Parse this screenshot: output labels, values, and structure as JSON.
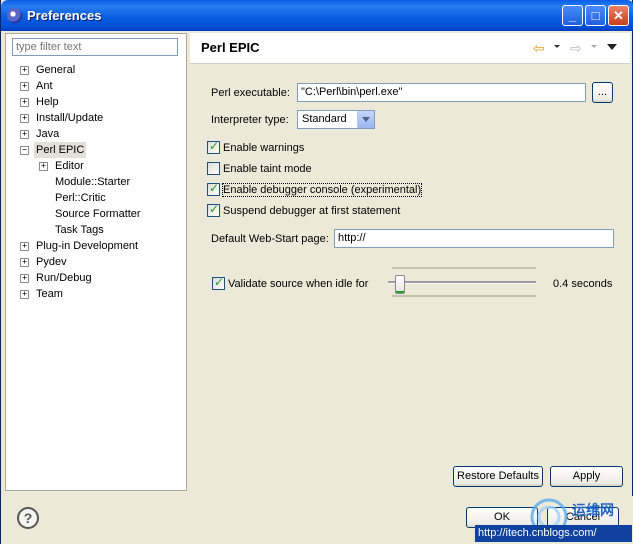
{
  "window": {
    "title": "Preferences"
  },
  "filter": {
    "placeholder": "type filter text"
  },
  "tree": {
    "items": [
      {
        "label": "General",
        "expandable": true
      },
      {
        "label": "Ant",
        "expandable": true
      },
      {
        "label": "Help",
        "expandable": true
      },
      {
        "label": "Install/Update",
        "expandable": true
      },
      {
        "label": "Java",
        "expandable": true
      },
      {
        "label": "Perl EPIC",
        "expandable": true,
        "expanded": true,
        "selected": true
      },
      {
        "label": "Editor",
        "expandable": true,
        "child": true
      },
      {
        "label": "Module::Starter",
        "child": true
      },
      {
        "label": "Perl::Critic",
        "child": true
      },
      {
        "label": "Source Formatter",
        "child": true
      },
      {
        "label": "Task Tags",
        "child": true
      },
      {
        "label": "Plug-in Development",
        "expandable": true
      },
      {
        "label": "Pydev",
        "expandable": true
      },
      {
        "label": "Run/Debug",
        "expandable": true
      },
      {
        "label": "Team",
        "expandable": true
      }
    ]
  },
  "page": {
    "title": "Perl EPIC",
    "perl_executable_label": "Perl executable:",
    "perl_executable_value": "\"C:\\Perl\\bin\\perl.exe\"",
    "browse_label": "...",
    "interpreter_label": "Interpreter type:",
    "interpreter_value": "Standard",
    "checkboxes": [
      {
        "label": "Enable warnings",
        "checked": true
      },
      {
        "label": "Enable taint mode",
        "checked": false
      },
      {
        "label": "Enable debugger console (experimental)",
        "checked": true
      },
      {
        "label": "Suspend debugger at first statement",
        "checked": true
      }
    ],
    "webstart_label": "Default Web-Start page:",
    "webstart_value": "http://",
    "validate_label": "Validate source when idle for",
    "validate_checked": true,
    "validate_seconds": "0.4 seconds",
    "restore_defaults": "Restore Defaults",
    "apply": "Apply"
  },
  "footer": {
    "help_glyph": "?",
    "ok": "OK",
    "cancel": "Cancel",
    "watermark_url": "http://itech.cnblogs.com/",
    "watermark_brand": "运维网"
  },
  "icons": {
    "back": "left-arrow-icon",
    "forward": "right-arrow-icon"
  }
}
